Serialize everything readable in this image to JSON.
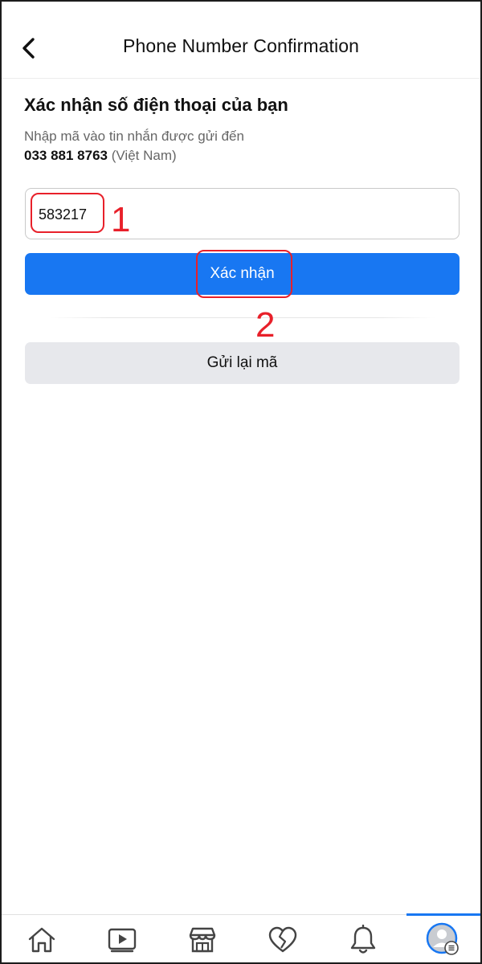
{
  "header": {
    "title": "Phone Number Confirmation",
    "back_icon": "chevron-left-icon"
  },
  "content": {
    "heading": "Xác nhận số điện thoại của bạn",
    "instruction": "Nhập mã vào tin nhắn được gửi đến",
    "phone_number": "033 881 8763",
    "country": "(Việt Nam)",
    "code_input": {
      "value": "583217",
      "placeholder": ""
    },
    "confirm_label": "Xác nhận",
    "resend_label": "Gửi lại mã"
  },
  "annotations": {
    "step1": "1",
    "step2": "2",
    "color": "#e8202a"
  },
  "tabbar": {
    "items": [
      {
        "icon": "home-icon"
      },
      {
        "icon": "video-icon"
      },
      {
        "icon": "marketplace-icon"
      },
      {
        "icon": "dating-heart-icon"
      },
      {
        "icon": "bell-icon"
      },
      {
        "icon": "profile-menu-icon",
        "active": true
      }
    ]
  },
  "colors": {
    "primary": "#1877f2",
    "secondary_button": "#e7e8ec",
    "text": "#111111",
    "muted": "#666666"
  }
}
